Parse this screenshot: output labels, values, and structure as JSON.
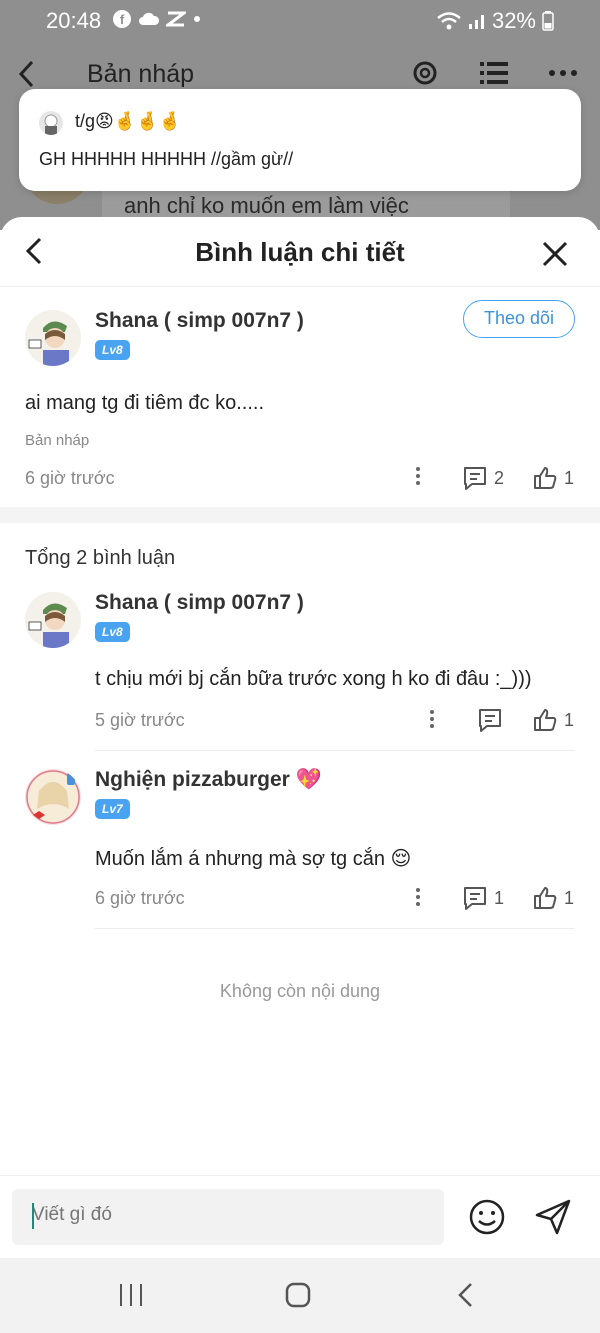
{
  "status_bar": {
    "time": "20:48",
    "battery": "32%"
  },
  "background_app": {
    "title": "Bản nháp",
    "snippet": "anh chỉ ko muốn em làm việc"
  },
  "notification": {
    "sender": "t/g😡🤞🤞🤞",
    "message": "GH HHHHH HHHHH //gầm gừ//"
  },
  "sheet": {
    "title": "Bình luận chi tiết"
  },
  "main_post": {
    "user": "Shana ( simp 007n7 )",
    "level": "Lv8",
    "follow_label": "Theo dõi",
    "text": "ai mang tg đi tiêm đc ko.....",
    "source": "Bản nháp",
    "time": "6 giờ trước",
    "comment_count": "2",
    "like_count": "1"
  },
  "total_label": "Tổng 2 bình luận",
  "comments": [
    {
      "user": "Shana ( simp 007n7 )",
      "level": "Lv8",
      "text": "t chịu mới bj cắn bữa trước xong h ko đi đâu :_)))",
      "time": "5 giờ trước",
      "reply_count": "",
      "like_count": "1"
    },
    {
      "user": "Nghiện pizzaburger 💖",
      "level": "Lv7",
      "text": "Muốn lắm á nhưng mà sợ tg cắn 😌",
      "time": "6 giờ trước",
      "reply_count": "1",
      "like_count": "1"
    }
  ],
  "end_label": "Không còn nội dung",
  "composer": {
    "placeholder": "Viết gì đó"
  },
  "colors": {
    "accent": "#4aa3f0",
    "background_dim": "#8f8f8f"
  }
}
